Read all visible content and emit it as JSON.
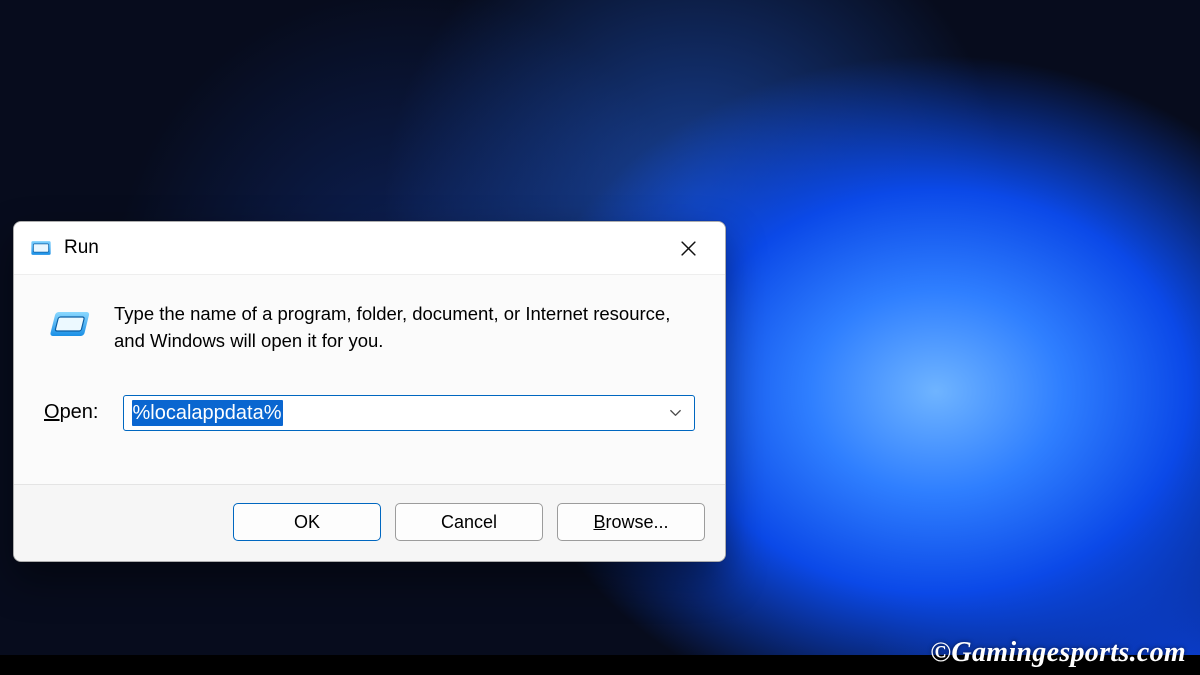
{
  "dialog": {
    "title": "Run",
    "info_text": "Type the name of a program, folder, document, or Internet resource, and Windows will open it for you.",
    "open_label_underlined": "O",
    "open_label_rest": "pen:",
    "input_value": "%localappdata%",
    "buttons": {
      "ok": "OK",
      "cancel": "Cancel",
      "browse_underlined": "B",
      "browse_rest": "rowse..."
    }
  },
  "watermark": "©Gamingesports.com"
}
